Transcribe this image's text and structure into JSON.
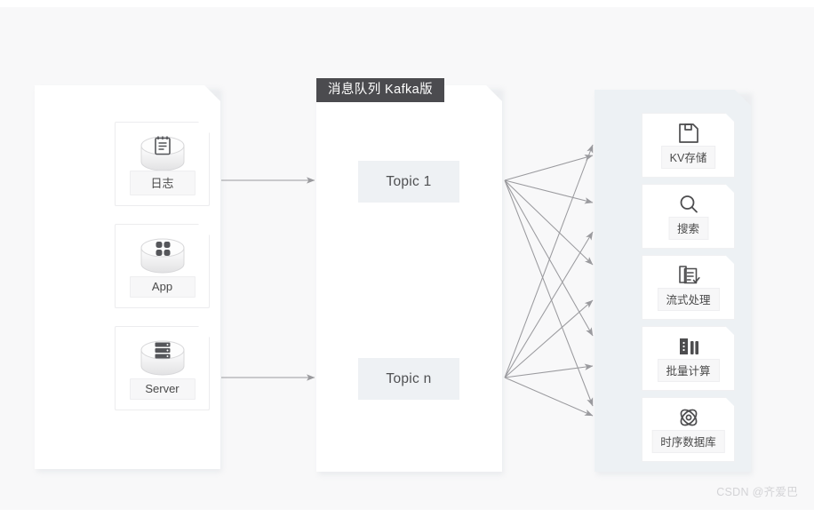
{
  "diagram": {
    "title_banner": "消息队列  Kafka版",
    "watermark": "CSDN @齐爱巴",
    "colors": {
      "canvas_bg": "#f8f8f9",
      "panel_bg": "#ffffff",
      "right_panel_bg": "#edf1f4",
      "banner_bg": "#4b4b4f",
      "topic_bg": "#eef1f4",
      "arrow": "#9a9a9e",
      "icon": "#4d4d4f",
      "text": "#4a4a4a",
      "watermark": "#d3d3d6"
    }
  },
  "producers": {
    "panel_name": "producer-panel",
    "items": [
      {
        "label": "日志",
        "icon": "notepad-icon"
      },
      {
        "label": "App",
        "icon": "apps-grid-icon"
      },
      {
        "label": "Server",
        "icon": "server-rack-icon"
      }
    ]
  },
  "kafka": {
    "panel_name": "kafka-panel",
    "topics": [
      {
        "label": "Topic 1"
      },
      {
        "label": "Topic n"
      }
    ]
  },
  "consumers": {
    "panel_name": "consumer-panel",
    "items": [
      {
        "label": "KV存储",
        "icon": "floppy-save-icon"
      },
      {
        "label": "搜索",
        "icon": "search-magnifier-icon"
      },
      {
        "label": "流式处理",
        "icon": "stream-documents-check-icon"
      },
      {
        "label": "批量计算",
        "icon": "bar-chart-icon"
      },
      {
        "label": "时序数据库",
        "icon": "atom-molecule-icon"
      }
    ]
  },
  "connections": {
    "producer_to_kafka": [
      {
        "from": "producer-panel",
        "to": "Topic 1"
      },
      {
        "from": "producer-panel",
        "to": "Topic n"
      }
    ],
    "kafka_to_consumer_fanout": [
      {
        "from": "Topic 1",
        "to": [
          "KV存储",
          "搜索",
          "流式处理",
          "批量计算",
          "时序数据库"
        ]
      },
      {
        "from": "Topic n",
        "to": [
          "KV存储",
          "搜索",
          "流式处理",
          "批量计算",
          "时序数据库"
        ]
      }
    ]
  }
}
